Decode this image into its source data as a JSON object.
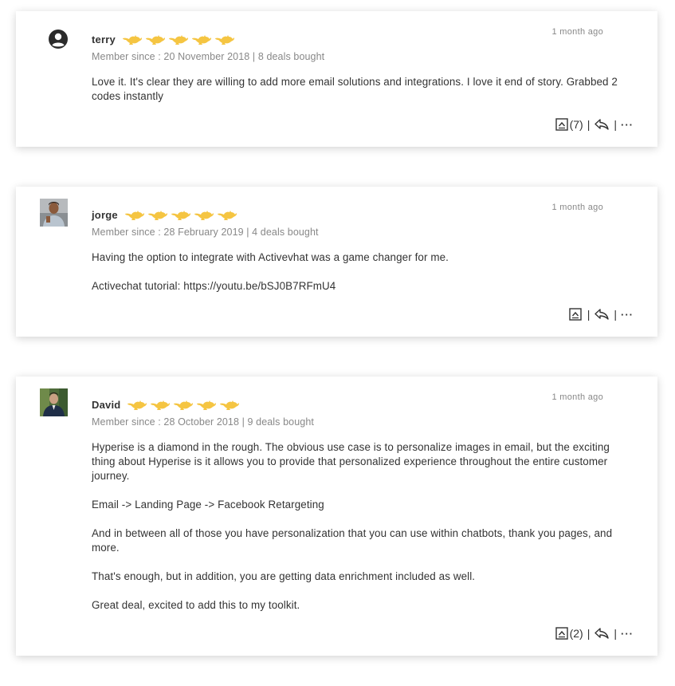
{
  "reviews": [
    {
      "username": "terry",
      "avatar": "user-circle-icon",
      "rating_icon": "genie-lamp-icon",
      "rating": 5,
      "member_line": "Member since : 20 November 2018 | 8 deals bought",
      "time": "1 month ago",
      "body": [
        "Love it. It's clear they are willing to add more email solutions and integrations. I love it end of story. Grabbed 2 codes instantly"
      ],
      "upvote_count": "(7)",
      "more": "···"
    },
    {
      "username": "jorge",
      "avatar": "user-photo",
      "rating_icon": "genie-lamp-icon",
      "rating": 5,
      "member_line": "Member since : 28 February 2019 | 4 deals bought",
      "time": "1 month ago",
      "body": [
        "Having the option to integrate with Activevhat was a game changer for me.",
        "",
        "Activechat tutorial: https://youtu.be/bSJ0B7RFmU4"
      ],
      "upvote_count": "",
      "more": "···"
    },
    {
      "username": "David",
      "avatar": "user-photo",
      "rating_icon": "genie-lamp-icon",
      "rating": 5,
      "member_line": "Member since : 28 October 2018 | 9 deals bought",
      "time": "1 month ago",
      "body": [
        "Hyperise is a diamond in the rough. The obvious use case is to personalize images in email, but the exciting thing about Hyperise is it allows you to provide that personalized experience throughout the entire customer journey.",
        "",
        "Email -> Landing Page -> Facebook Retargeting",
        "",
        "And in between all of those you have personalization that you can use within chatbots, thank you pages, and more.",
        "",
        "That's enough, but in addition, you are getting data enrichment included as well.",
        "",
        "Great deal, excited to add this to my toolkit."
      ],
      "upvote_count": "(2)",
      "more": "···"
    }
  ],
  "colors": {
    "lamp": "#f5c542",
    "text": "#333333",
    "muted": "#888888"
  }
}
